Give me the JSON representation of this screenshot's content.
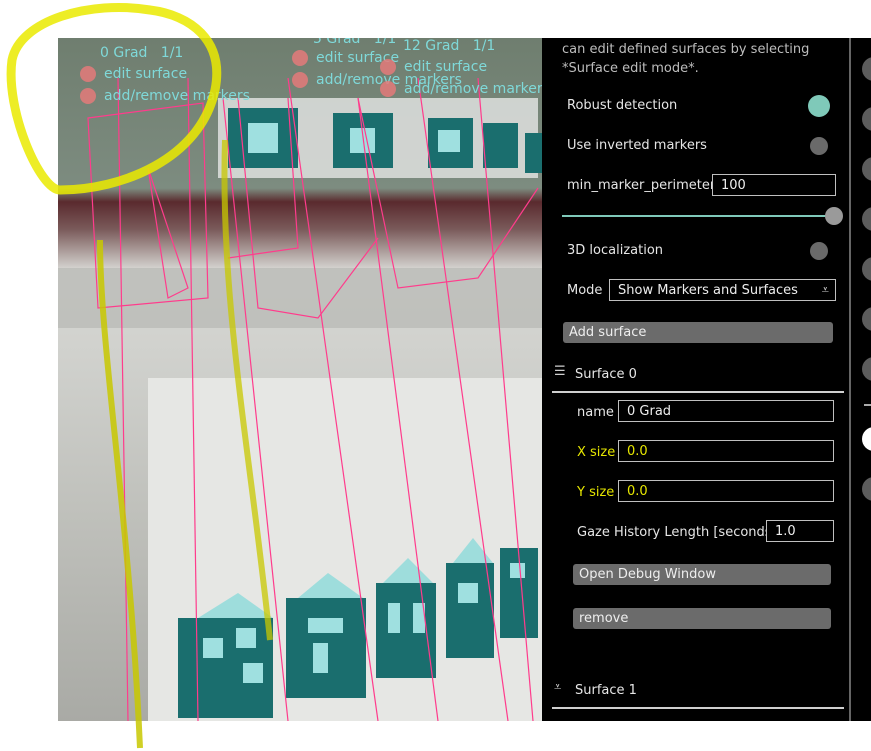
{
  "world_view": {
    "surface_labels": [
      {
        "name": "0 Grad",
        "frame": "1/1"
      },
      {
        "name": "5 Grad",
        "frame": "1/1"
      },
      {
        "name": "12 Grad",
        "frame": "1/1"
      }
    ],
    "edit_surface_label": "edit surface",
    "add_remove_markers_label": "add/remove markers"
  },
  "menu": {
    "intro_text": "can edit defined surfaces by selecting",
    "intro_text_2": "*Surface edit mode*.",
    "robust_detection": {
      "label": "Robust detection",
      "on": true
    },
    "inverted_markers": {
      "label": "Use inverted markers",
      "on": false
    },
    "min_marker_perimeter": {
      "label": "min_marker_perimeter",
      "value": "100",
      "slider_fraction": 1.0
    },
    "localization_3d": {
      "label": "3D localization",
      "on": false
    },
    "mode": {
      "label": "Mode",
      "value": "Show Markers and Surfaces"
    },
    "add_surface_label": "Add surface",
    "surface0": {
      "title": "Surface 0",
      "name_label": "name",
      "name_value": "0 Grad",
      "x_label": "X size",
      "x_value": "0.0",
      "y_label": "Y size",
      "y_value": "0.0",
      "gaze_label": "Gaze History Length [seconds]",
      "gaze_value": "1.0",
      "debug_label": "Open Debug Window",
      "remove_label": "remove"
    },
    "surface1": {
      "title": "Surface 1"
    }
  },
  "colors": {
    "accent": "#7fc9b9",
    "warning_label": "#e6e600",
    "overlay_text": "#7fd9d9",
    "surface_outline": "#ff3c8c",
    "annotation": "#eaea00"
  }
}
